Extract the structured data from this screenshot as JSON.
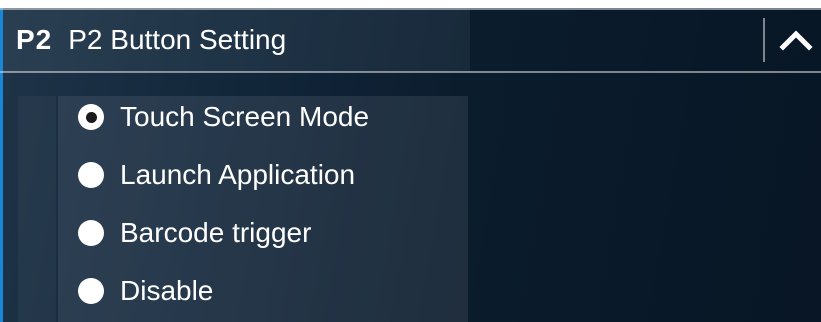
{
  "header": {
    "badge": "P2",
    "title": "P2 Button Setting",
    "collapse_icon": "chevron-up-icon"
  },
  "options": [
    {
      "label": "Touch Screen Mode",
      "selected": true
    },
    {
      "label": "Launch Application",
      "selected": false
    },
    {
      "label": "Barcode trigger",
      "selected": false
    },
    {
      "label": "Disable",
      "selected": false
    }
  ],
  "colors": {
    "accent": "#1a86d8",
    "background": "#0b1c2d",
    "text": "#ffffff"
  }
}
